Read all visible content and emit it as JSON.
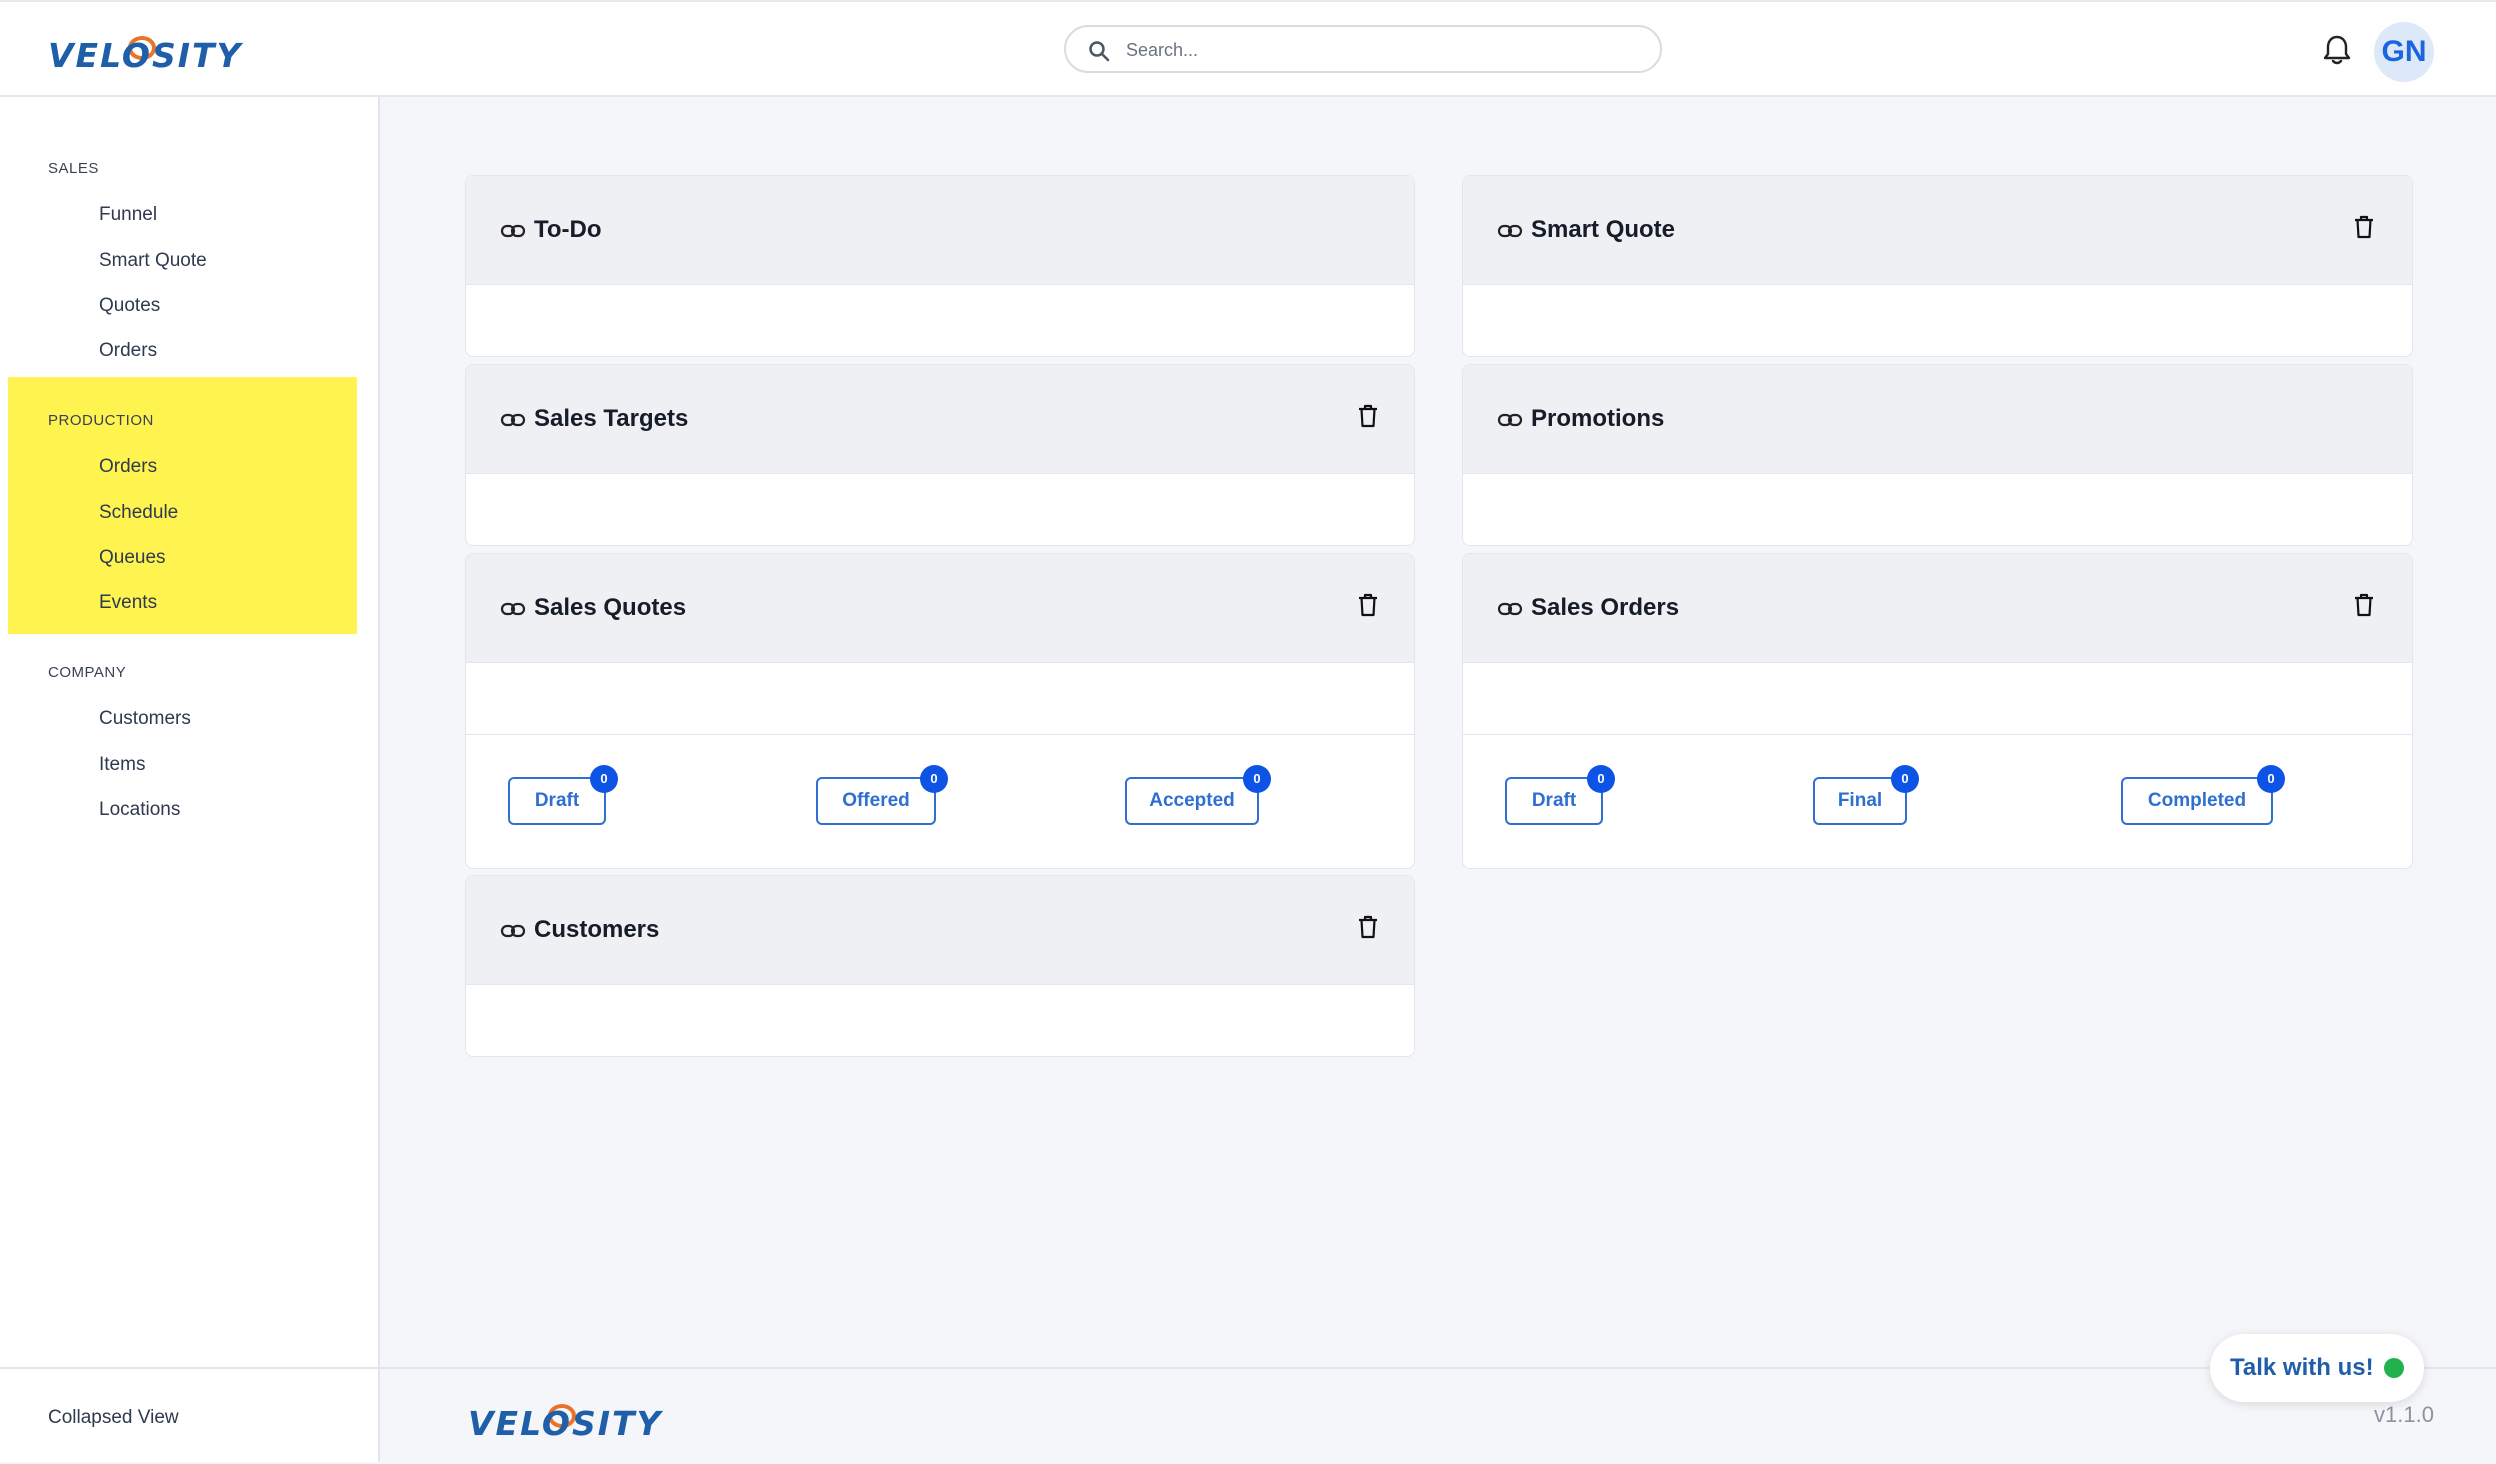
{
  "app": {
    "logo_text": "VELOSITY",
    "version": "v1.1.0"
  },
  "header": {
    "search_placeholder": "Search...",
    "avatar_initials": "GN"
  },
  "sidebar": {
    "sections": [
      {
        "title": "SALES",
        "items": [
          "Funnel",
          "Smart Quote",
          "Quotes",
          "Orders"
        ]
      },
      {
        "title": "PRODUCTION",
        "items": [
          "Orders",
          "Schedule",
          "Queues",
          "Events"
        ]
      },
      {
        "title": "COMPANY",
        "items": [
          "Customers",
          "Items",
          "Locations"
        ]
      }
    ],
    "collapsed_view": "Collapsed View"
  },
  "cards": {
    "todo": {
      "title": "To-Do"
    },
    "smart_quote": {
      "title": "Smart Quote"
    },
    "sales_targets": {
      "title": "Sales Targets"
    },
    "promotions": {
      "title": "Promotions"
    },
    "sales_quotes": {
      "title": "Sales Quotes",
      "statuses": [
        {
          "label": "Draft",
          "count": "0"
        },
        {
          "label": "Offered",
          "count": "0"
        },
        {
          "label": "Accepted",
          "count": "0"
        }
      ]
    },
    "sales_orders": {
      "title": "Sales Orders",
      "statuses": [
        {
          "label": "Draft",
          "count": "0"
        },
        {
          "label": "Final",
          "count": "0"
        },
        {
          "label": "Completed",
          "count": "0"
        }
      ]
    },
    "customers": {
      "title": "Customers"
    }
  },
  "chat": {
    "label": "Talk with us!"
  },
  "colors": {
    "accent": "#2f6fd1",
    "badge": "#0d53e6",
    "highlight": "#fff34f",
    "online": "#22b14c"
  }
}
